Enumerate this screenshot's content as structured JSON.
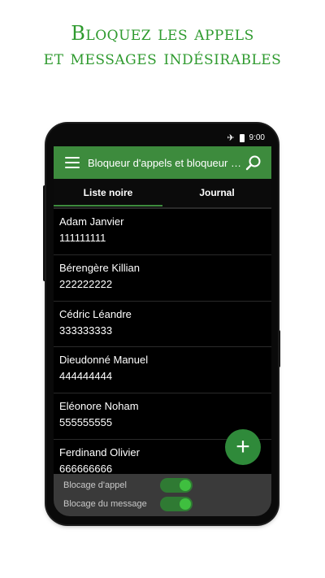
{
  "headline": {
    "line1": "Bloquez les appels",
    "line2": "et messages indésirables"
  },
  "status_bar": {
    "time": "9:00",
    "icons": [
      "airplane-icon",
      "battery-icon"
    ]
  },
  "app_bar": {
    "title": "Bloqueur d'appels et bloqueur de messages",
    "menu_icon": "hamburger-menu-icon",
    "search_icon": "search-icon"
  },
  "tabs": [
    {
      "label": "Liste noire",
      "active": true
    },
    {
      "label": "Journal",
      "active": false
    }
  ],
  "contacts": [
    {
      "name": "Adam Janvier",
      "number": "111111111"
    },
    {
      "name": "Bérengère Killian",
      "number": "222222222"
    },
    {
      "name": "Cédric Léandre",
      "number": "333333333"
    },
    {
      "name": "Dieudonné Manuel",
      "number": "444444444"
    },
    {
      "name": "Eléonore Noham",
      "number": "555555555"
    },
    {
      "name": "Ferdinand Olivier",
      "number": "666666666"
    }
  ],
  "fab": {
    "label": "+"
  },
  "toggles": {
    "call_block": {
      "label": "Blocage d'appel",
      "on": true
    },
    "message_block": {
      "label": "Blocage du message",
      "on": true
    }
  },
  "colors": {
    "accent_green": "#3d8b3d",
    "headline_green": "#2e9a2e",
    "toggle_green": "#3fbf3f",
    "background_dark": "#000000"
  }
}
